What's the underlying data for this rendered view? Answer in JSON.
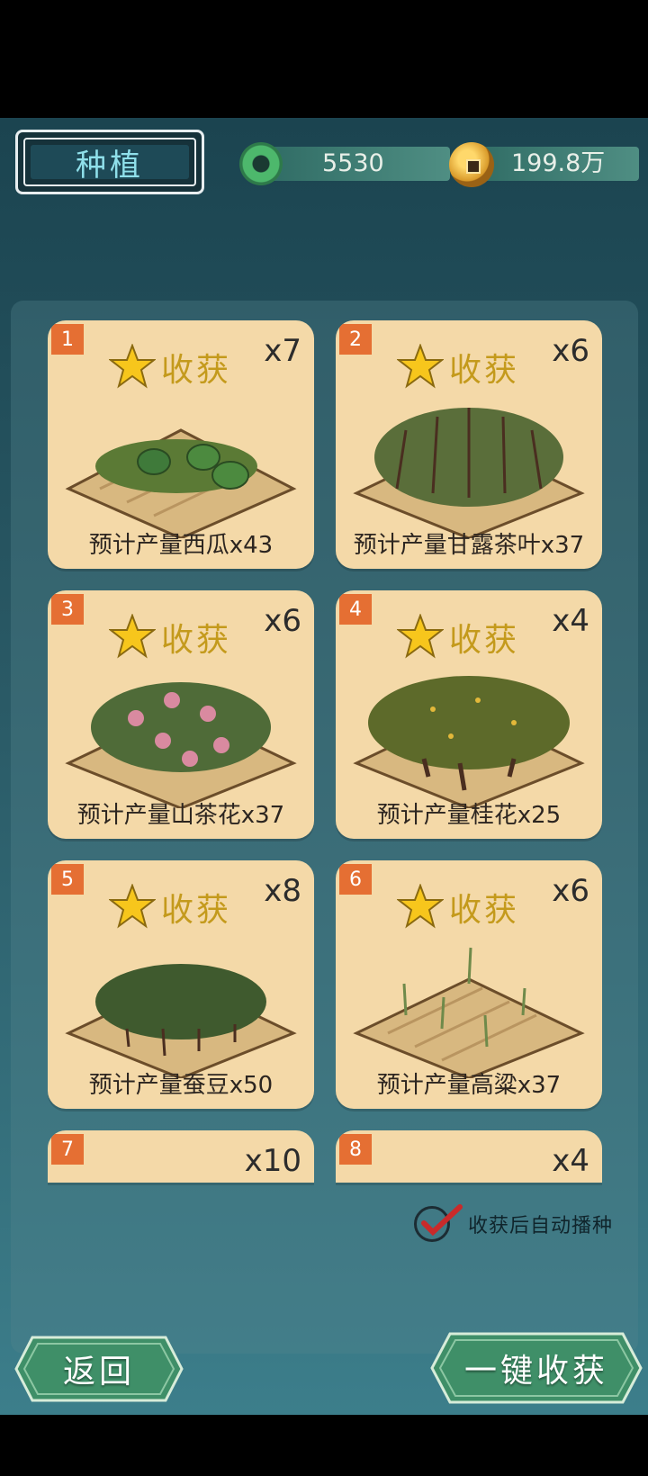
{
  "header": {
    "title": "种植",
    "jade_amount": "5530",
    "coin_amount": "199.8万"
  },
  "plots": [
    {
      "index": "1",
      "status": "收获",
      "count": "x7",
      "yield": "预计产量西瓜x43",
      "crop": "watermelon"
    },
    {
      "index": "2",
      "status": "收获",
      "count": "x6",
      "yield": "预计产量甘露茶叶x37",
      "crop": "tea"
    },
    {
      "index": "3",
      "status": "收获",
      "count": "x6",
      "yield": "预计产量山茶花x37",
      "crop": "camellia"
    },
    {
      "index": "4",
      "status": "收获",
      "count": "x4",
      "yield": "预计产量桂花x25",
      "crop": "osmanthus"
    },
    {
      "index": "5",
      "status": "收获",
      "count": "x8",
      "yield": "预计产量蚕豆x50",
      "crop": "broad-bean"
    },
    {
      "index": "6",
      "status": "收获",
      "count": "x6",
      "yield": "预计产量高粱x37",
      "crop": "sorghum"
    },
    {
      "index": "7",
      "count": "x10"
    },
    {
      "index": "8",
      "count": "x4"
    }
  ],
  "auto_sow": {
    "label": "收获后自动播种",
    "checked": true
  },
  "buttons": {
    "back": "返回",
    "harvest_all": "一键收获"
  },
  "colors": {
    "card": "#f4d9a8",
    "badge": "#e56f33",
    "harvest_text": "#c49a1c",
    "button": "#3f8f68"
  }
}
